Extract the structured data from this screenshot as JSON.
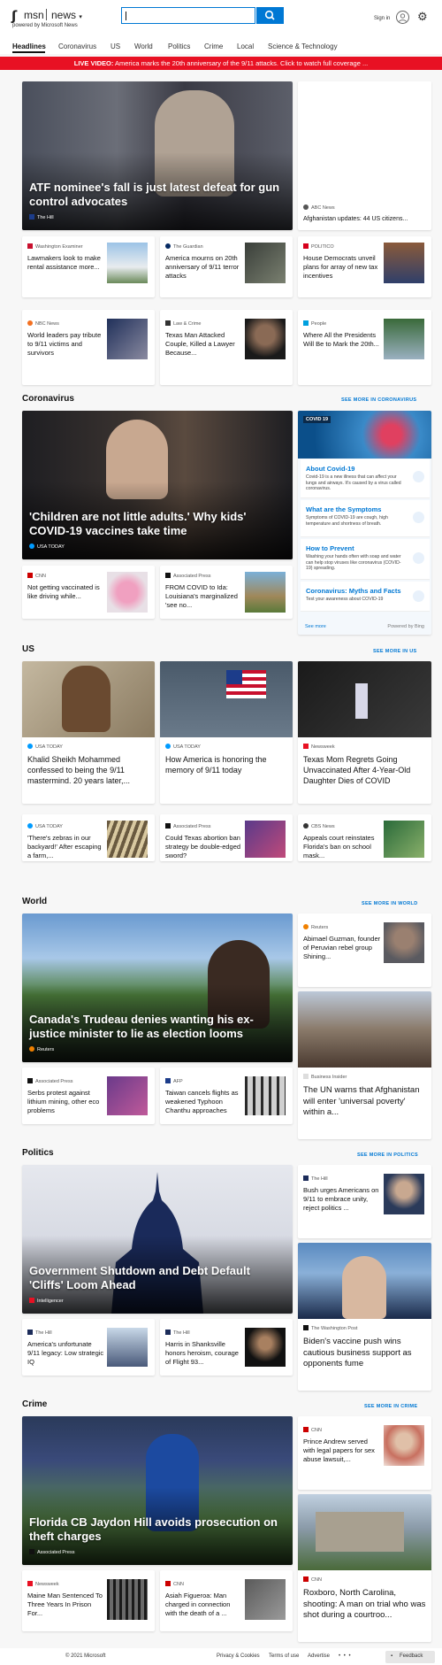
{
  "header": {
    "logo_glyph": "ʃ",
    "logo_text": "msn",
    "section": "news",
    "powered_by": "powered by Microsoft News",
    "search_placeholder": "",
    "signin": "Sign in"
  },
  "nav": [
    "Headlines",
    "Coronavirus",
    "US",
    "World",
    "Politics",
    "Crime",
    "Local",
    "Science & Technology"
  ],
  "banner": {
    "prefix": "LIVE VIDEO:",
    "text": "America marks the 20th anniversary of the 9/11 attacks. Click to watch full coverage ..."
  },
  "top": {
    "hero": {
      "title": "ATF nominee's fall is just latest defeat for gun control advocates",
      "source": "The Hill"
    },
    "side": {
      "source": "ABC News",
      "title": "Afghanistan updates: 44 US citizens..."
    },
    "row1": [
      {
        "source": "Washington Examiner",
        "title": "Lawmakers look to make rental assistance more..."
      },
      {
        "source": "The Guardian",
        "title": "America mourns on 20th anniversary of 9/11 terror attacks"
      },
      {
        "source": "POLITICO",
        "title": "House Democrats unveil plans for array of new tax incentives"
      }
    ],
    "row2": [
      {
        "source": "NBC News",
        "title": "World leaders pay tribute to 9/11 victims and survivors"
      },
      {
        "source": "Law & Crime",
        "title": "Texas Man Attacked Couple, Killed a Lawyer Because..."
      },
      {
        "source": "People",
        "title": "Where All the Presidents Will Be to Mark the 20th..."
      }
    ]
  },
  "coronavirus": {
    "heading": "Coronavirus",
    "see_more": "SEE MORE IN CORONAVIRUS",
    "hero": {
      "title": "'Children are not little adults.' Why kids' COVID-19 vaccines take time",
      "source": "USA TODAY"
    },
    "small": [
      {
        "source": "CNN",
        "title": "Not getting vaccinated is like driving while..."
      },
      {
        "source": "Associated Press",
        "title": "FROM COVID to Ida: Louisiana's marginalized 'see no..."
      }
    ],
    "panel": {
      "tag": "COVID 19",
      "items": [
        {
          "title": "About Covid-19",
          "desc": "Covid-19 is a new illness that can affect your lungs and airways. It's caused by a virus called coronavirus."
        },
        {
          "title": "What are the Symptoms",
          "desc": "Symptoms of COVID-19 are cough, high temperature and shortness of breath."
        },
        {
          "title": "How to Prevent",
          "desc": "Washing your hands often with soap and water can help stop viruses like coronavirus (COVID-19) spreading."
        },
        {
          "title": "Coronavirus: Myths and Facts",
          "desc": "Test your awareness about COVID-19"
        }
      ],
      "see_more": "See more",
      "powered": "Powered by Bing"
    }
  },
  "us": {
    "heading": "US",
    "see_more": "SEE MORE IN US",
    "big": [
      {
        "source": "USA TODAY",
        "title": "Khalid Sheikh Mohammed confessed to being the 9/11 mastermind. 20 years later,..."
      },
      {
        "source": "USA TODAY",
        "title": "How America is honoring the memory of 9/11 today"
      },
      {
        "source": "Newsweek",
        "title": "Texas Mom Regrets Going Unvaccinated After 4-Year-Old Daughter Dies of COVID"
      }
    ],
    "small": [
      {
        "source": "USA TODAY",
        "title": "'There's zebras in our backyard!' After escaping a farm,..."
      },
      {
        "source": "Associated Press",
        "title": "Could Texas abortion ban strategy be double-edged sword?"
      },
      {
        "source": "CBS News",
        "title": "Appeals court reinstates Florida's ban on school mask..."
      }
    ]
  },
  "world": {
    "heading": "World",
    "see_more": "SEE MORE IN WORLD",
    "hero": {
      "title": "Canada's Trudeau denies wanting his ex-justice minister to lie as election looms",
      "source": "Reuters"
    },
    "side1": {
      "source": "Reuters",
      "title": "Abimael Guzman, founder of Peruvian rebel group Shining..."
    },
    "side2": {
      "source": "Business Insider",
      "title": "The UN warns that Afghanistan will enter 'universal poverty' within a..."
    },
    "small": [
      {
        "source": "Associated Press",
        "title": "Serbs protest against lithium mining, other eco problems"
      },
      {
        "source": "AFP",
        "title": "Taiwan cancels flights as weakened Typhoon Chanthu approaches"
      }
    ]
  },
  "politics": {
    "heading": "Politics",
    "see_more": "SEE MORE IN POLITICS",
    "hero": {
      "title": "Government Shutdown and Debt Default 'Cliffs' Loom Ahead",
      "source": "Intelligencer"
    },
    "side1": {
      "source": "The Hill",
      "title": "Bush urges Americans on 9/11 to embrace unity, reject politics ..."
    },
    "side2": {
      "source": "The Washington Post",
      "title": "Biden's vaccine push wins cautious business support as opponents fume"
    },
    "small": [
      {
        "source": "The Hill",
        "title": "America's unfortunate 9/11 legacy: Low strategic IQ"
      },
      {
        "source": "The Hill",
        "title": "Harris in Shanksville honors heroism, courage of Flight 93..."
      }
    ]
  },
  "crime": {
    "heading": "Crime",
    "see_more": "SEE MORE IN CRIME",
    "hero": {
      "title": "Florida CB Jaydon Hill avoids prosecution on theft charges",
      "source": "Associated Press"
    },
    "side1": {
      "source": "CNN",
      "title": "Prince Andrew served with legal papers for sex abuse lawsuit,..."
    },
    "side2": {
      "source": "CNN",
      "title": "Roxboro, North Carolina, shooting: A man on trial who was shot during a courtroo..."
    },
    "small": [
      {
        "source": "Newsweek",
        "title": "Maine Man Sentenced To Three Years In Prison For..."
      },
      {
        "source": "CNN",
        "title": "Asiah Figueroa: Man charged in connection with the death of a ..."
      }
    ]
  },
  "footer": {
    "copyright": "© 2021 Microsoft",
    "links": [
      "Privacy & Cookies",
      "Terms of use",
      "Advertise"
    ],
    "more": "• • •",
    "feedback": "Feedback"
  },
  "colors": {
    "accent": "#0078d4",
    "banner": "#e81123"
  }
}
